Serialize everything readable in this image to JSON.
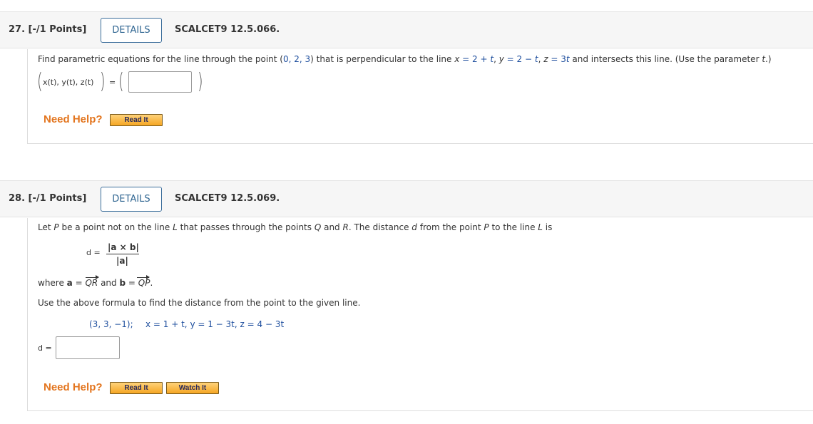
{
  "q27": {
    "number_label": "27.  [-/1 Points]",
    "details_label": "DETAILS",
    "code": "SCALCET9 12.5.066.",
    "prompt_start": "Find parametric equations for the line through the point (",
    "point": "0, 2, 3",
    "prompt_mid": ") that is perpendicular to the line ",
    "line_x": "x",
    "line_x_val": " = 2 + ",
    "t1": "t",
    "comma1": ", ",
    "line_y": "y",
    "line_y_val": " = 2 − ",
    "t2": "t",
    "comma2": ", ",
    "line_z": "z",
    "line_z_val": " = 3",
    "t3": "t",
    "prompt_end": " and intersects this line. (Use the parameter ",
    "param": "t",
    "prompt_close": ".)",
    "vector_label": "x(t), y(t), z(t)",
    "equals": "=",
    "answer_value": "",
    "need_help": "Need Help?",
    "read_it": "Read It"
  },
  "q28": {
    "number_label": "28.  [-/1 Points]",
    "details_label": "DETAILS",
    "code": "SCALCET9 12.5.069.",
    "intro_1": "Let ",
    "P": "P",
    "intro_2": " be a point not on the line ",
    "L": "L",
    "intro_3": " that passes through the points ",
    "Q": "Q",
    "intro_4": " and ",
    "R": "R",
    "intro_5": ". The distance ",
    "d": "d",
    "intro_6": " from the point ",
    "P2": "P",
    "intro_7": " to the line ",
    "L2": "L",
    "intro_8": " is",
    "formula_lhs": "d =",
    "formula_num": "|a × b|",
    "formula_den": "|a|",
    "where_1": "where ",
    "a": "a",
    "where_2": " = ",
    "QR": "QR",
    "where_3": " and ",
    "b": "b",
    "where_4": " = ",
    "QP": "QP",
    "where_5": ".",
    "instruction": "Use the above formula to find the distance from the point to the given line.",
    "given_point": "(3, 3, −1);",
    "given_line": "x = 1 + t, y = 1 − 3t, z = 4 − 3t",
    "answer_label": "d =",
    "answer_value": "",
    "need_help": "Need Help?",
    "read_it": "Read It",
    "watch_it": "Watch It"
  }
}
